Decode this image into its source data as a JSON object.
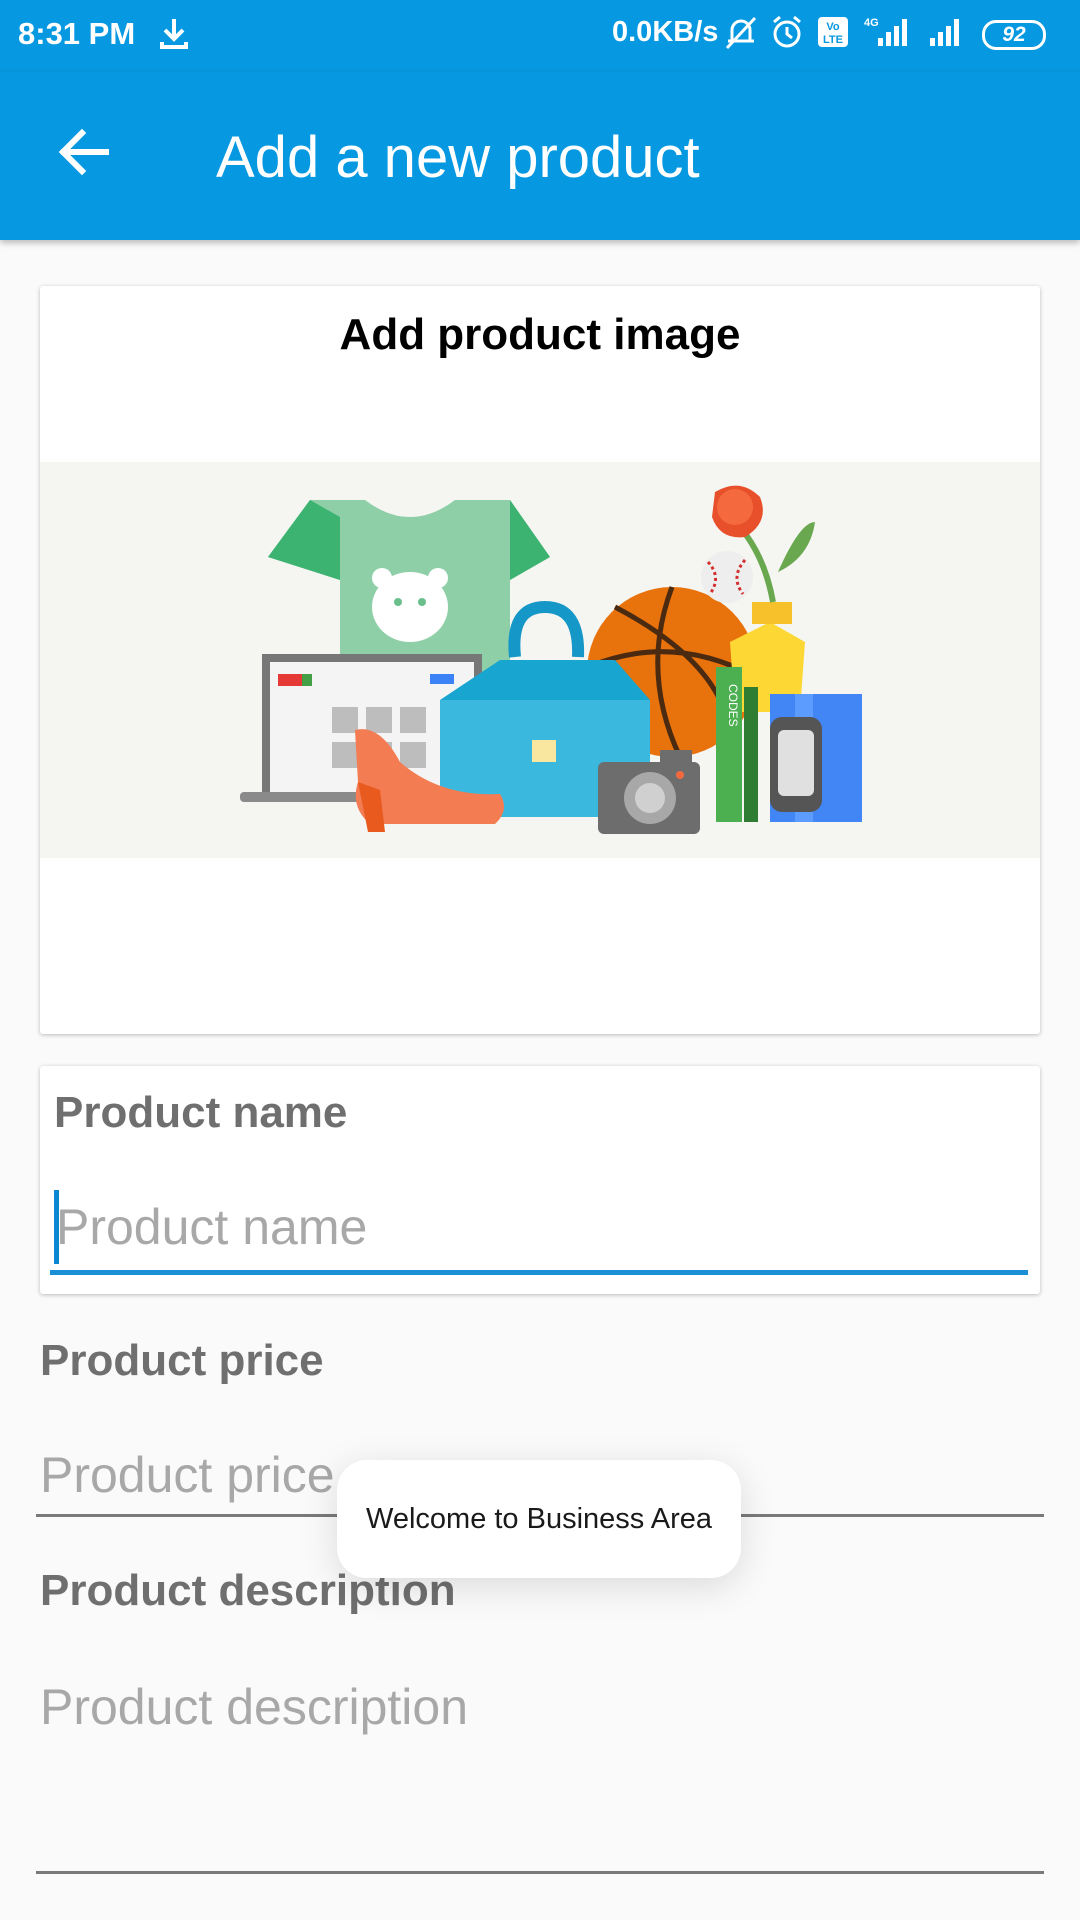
{
  "status_bar": {
    "time": "8:31 PM",
    "network_speed": "0.0KB/s",
    "battery": "92",
    "icons": [
      "download-icon",
      "mute-bell-icon",
      "alarm-icon",
      "volte-icon",
      "signal-icon",
      "signal-icon"
    ]
  },
  "app_bar": {
    "title": "Add a new product",
    "back_icon": "arrow-back-icon",
    "color": "#0698e0"
  },
  "image_card": {
    "title": "Add product image"
  },
  "fields": {
    "name": {
      "label": "Product name",
      "placeholder": "Product name"
    },
    "price": {
      "label": "Product price",
      "placeholder": "Product price"
    },
    "description": {
      "label": "Product description",
      "placeholder": "Product description"
    }
  },
  "toast": {
    "message": "Welcome to Business Area"
  },
  "colors": {
    "accent": "#1a8fd6",
    "background": "#fafafa"
  }
}
